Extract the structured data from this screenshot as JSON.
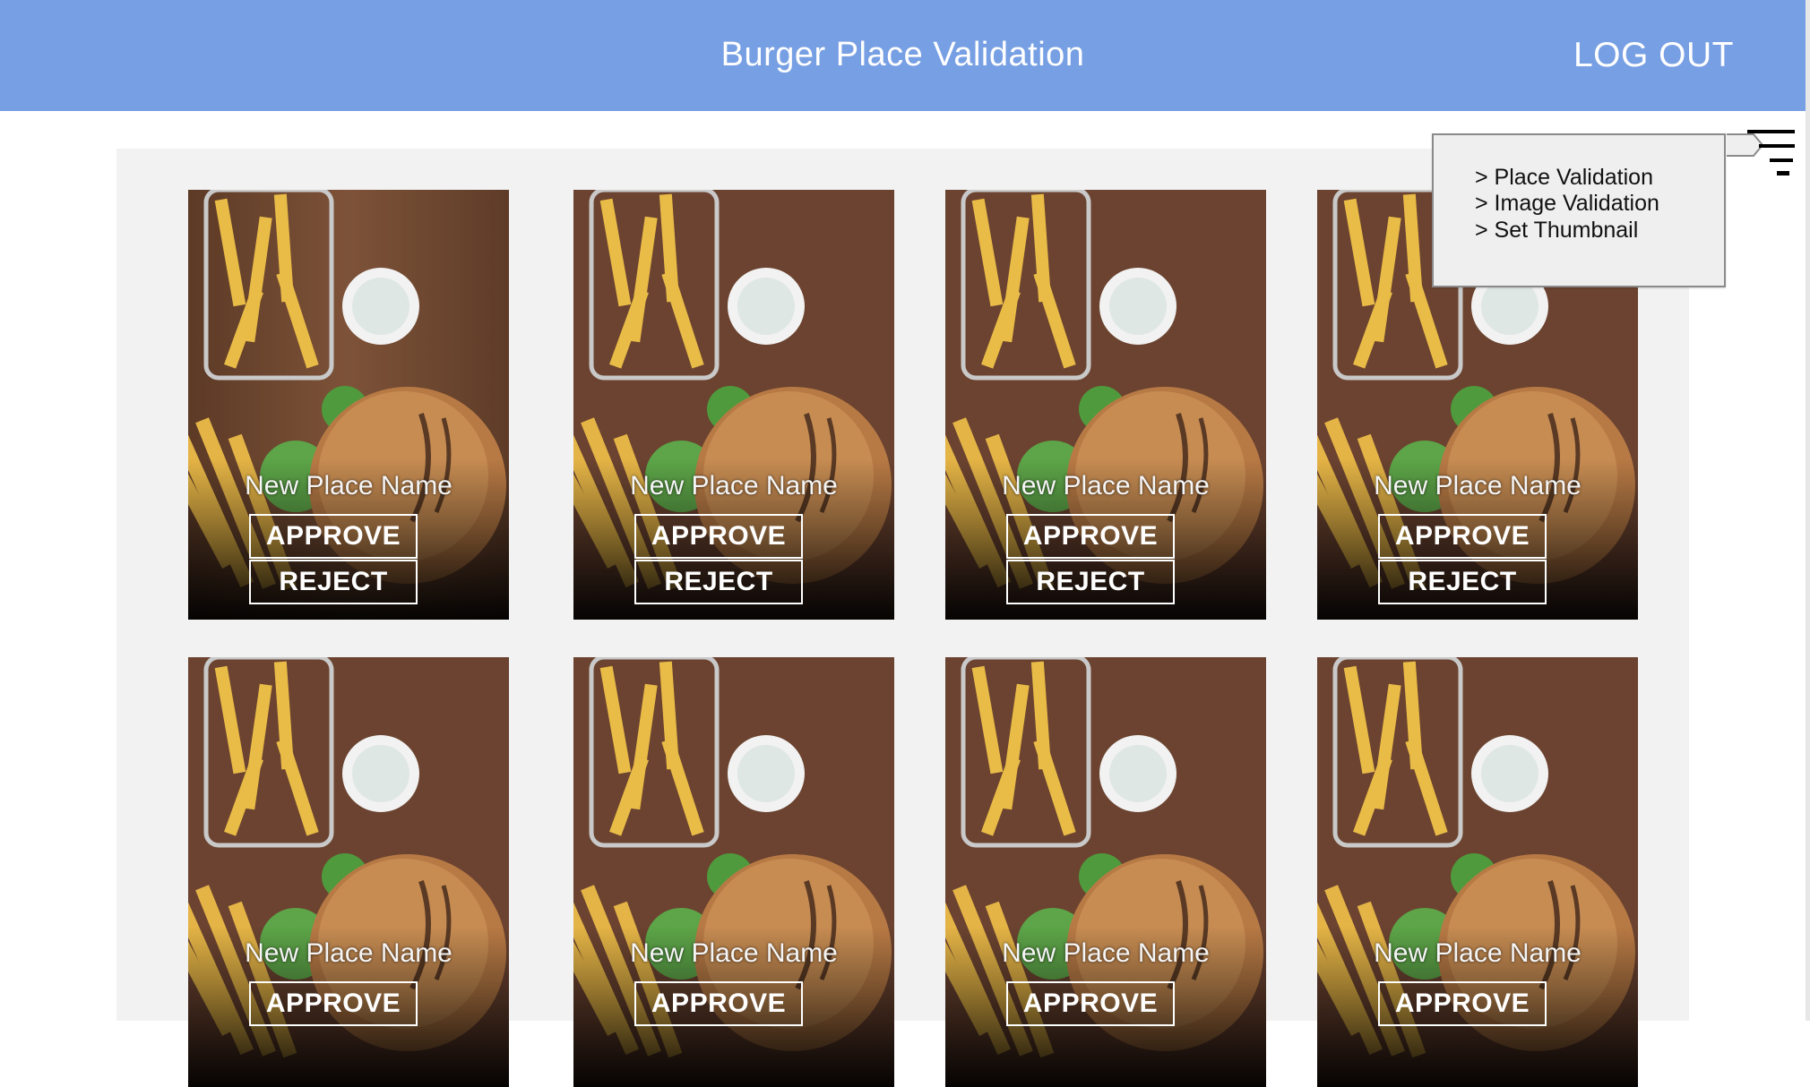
{
  "header": {
    "title": "Burger Place Validation",
    "logout_label": "LOG OUT"
  },
  "colors": {
    "appbar": "#779fe3",
    "content_bg": "#f2f2f2",
    "popup_bg": "#efefef"
  },
  "menu": {
    "items": [
      {
        "label": "> Place Validation"
      },
      {
        "label": "> Image Validation"
      },
      {
        "label": "> Set Thumbnail"
      }
    ]
  },
  "filter_icon": "filter-list-icon",
  "places": [
    {
      "name": "New Place Name",
      "approve_label": "APPROVE",
      "reject_label": "REJECT"
    },
    {
      "name": "New Place Name",
      "approve_label": "APPROVE",
      "reject_label": "REJECT"
    },
    {
      "name": "New Place Name",
      "approve_label": "APPROVE",
      "reject_label": "REJECT"
    },
    {
      "name": "New Place Name",
      "approve_label": "APPROVE",
      "reject_label": "REJECT"
    },
    {
      "name": "New Place Name",
      "approve_label": "APPROVE"
    },
    {
      "name": "New Place Name",
      "approve_label": "APPROVE"
    },
    {
      "name": "New Place Name",
      "approve_label": "APPROVE"
    },
    {
      "name": "New Place Name",
      "approve_label": "APPROVE"
    }
  ]
}
